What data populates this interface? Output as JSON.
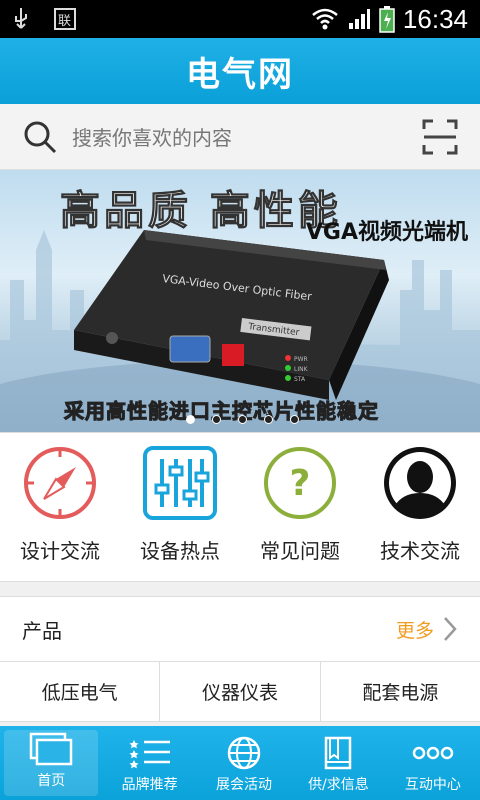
{
  "status": {
    "time": "16:34"
  },
  "header": {
    "title": "电气网"
  },
  "search": {
    "placeholder": "搜索你喜欢的内容"
  },
  "banner": {
    "headline": "高品质  高性能",
    "product": "VGA视频光端机",
    "tagline": "采用高性能进口主控芯片性能稳定",
    "device_label": "VGA-Video Over Optic Fiber",
    "device_badge": "Transmitter",
    "leds": [
      "PWR",
      "LINK",
      "STA"
    ],
    "slides": 5,
    "active_slide": 0
  },
  "quick_links": [
    {
      "label": "设计交流",
      "icon": "compass-icon",
      "color": "#e35b5b"
    },
    {
      "label": "设备热点",
      "icon": "equalizer-icon",
      "color": "#1aa4dc"
    },
    {
      "label": "常见问题",
      "icon": "question-icon",
      "color": "#8cae3b"
    },
    {
      "label": "技术交流",
      "icon": "person-icon",
      "color": "#111111"
    }
  ],
  "products": {
    "title": "产品",
    "more": "更多",
    "categories": [
      "低压电气",
      "仪器仪表",
      "配套电源"
    ]
  },
  "tabbar": [
    {
      "label": "首页",
      "icon": "home-icon",
      "active": true
    },
    {
      "label": "品牌推荐",
      "icon": "star-list-icon",
      "active": false
    },
    {
      "label": "展会活动",
      "icon": "globe-icon",
      "active": false
    },
    {
      "label": "供/求信息",
      "icon": "book-icon",
      "active": false
    },
    {
      "label": "互动中心",
      "icon": "dots-icon",
      "active": false
    }
  ],
  "colors": {
    "brand": "#0aa0d8",
    "accent": "#f29c1f"
  }
}
